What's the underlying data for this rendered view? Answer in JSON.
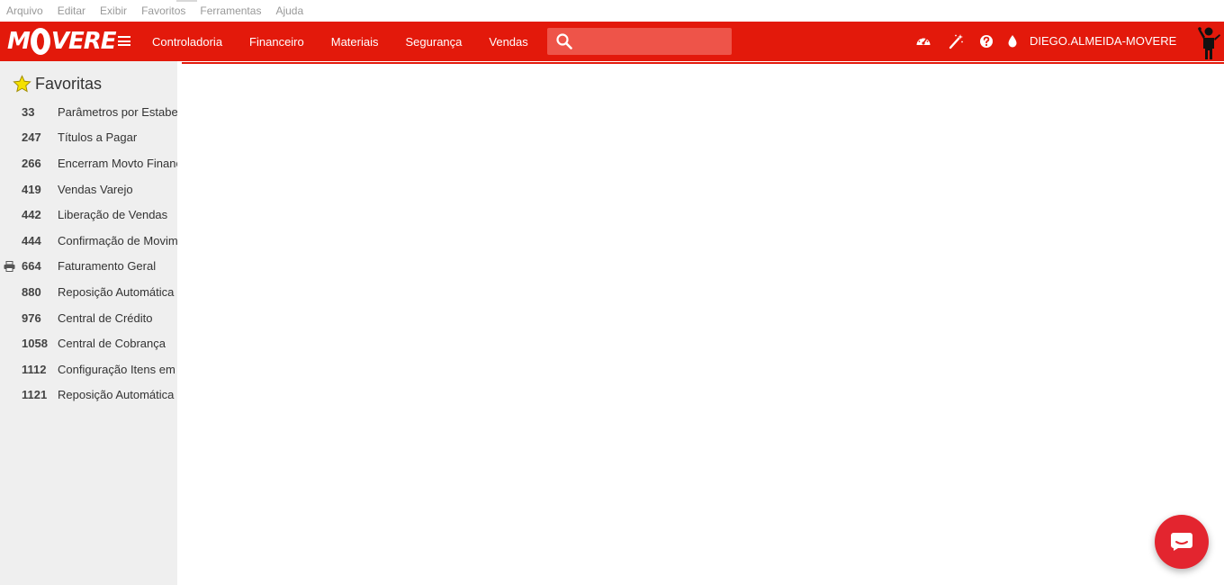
{
  "menubar": {
    "items": [
      "Arquivo",
      "Editar",
      "Exibir",
      "Favoritos",
      "Ferramentas",
      "Ajuda"
    ]
  },
  "header": {
    "logo_text": "MOVERE",
    "nav": [
      "Controladoria",
      "Financeiro",
      "Materiais",
      "Segurança",
      "Vendas"
    ],
    "search": {
      "value": "",
      "placeholder": ""
    },
    "icons": [
      "dashboard-icon",
      "magic-wand-icon",
      "help-icon",
      "drop-icon"
    ],
    "username": "DIEGO.ALMEIDA-MOVERE",
    "colors": {
      "primary": "#e3190b",
      "search_bg": "#ee5449"
    }
  },
  "sidebar": {
    "title": "Favoritas",
    "items": [
      {
        "code": "33",
        "label": "Parâmetros por Estabe"
      },
      {
        "code": "247",
        "label": "Títulos a Pagar"
      },
      {
        "code": "266",
        "label": "Encerram Movto Financ"
      },
      {
        "code": "419",
        "label": "Vendas Varejo"
      },
      {
        "code": "442",
        "label": "Liberação de Vendas"
      },
      {
        "code": "444",
        "label": "Confirmação de Movim"
      },
      {
        "code": "664",
        "label": "Faturamento Geral",
        "icon": "printer-icon"
      },
      {
        "code": "880",
        "label": "Reposição Automática"
      },
      {
        "code": "976",
        "label": "Central de Crédito"
      },
      {
        "code": "1058",
        "label": "Central de Cobrança"
      },
      {
        "code": "1112",
        "label": "Configuração Itens em"
      },
      {
        "code": "1121",
        "label": "Reposição Automática"
      }
    ]
  },
  "chat": {
    "icon": "chat-icon",
    "color": "#e3252f"
  }
}
